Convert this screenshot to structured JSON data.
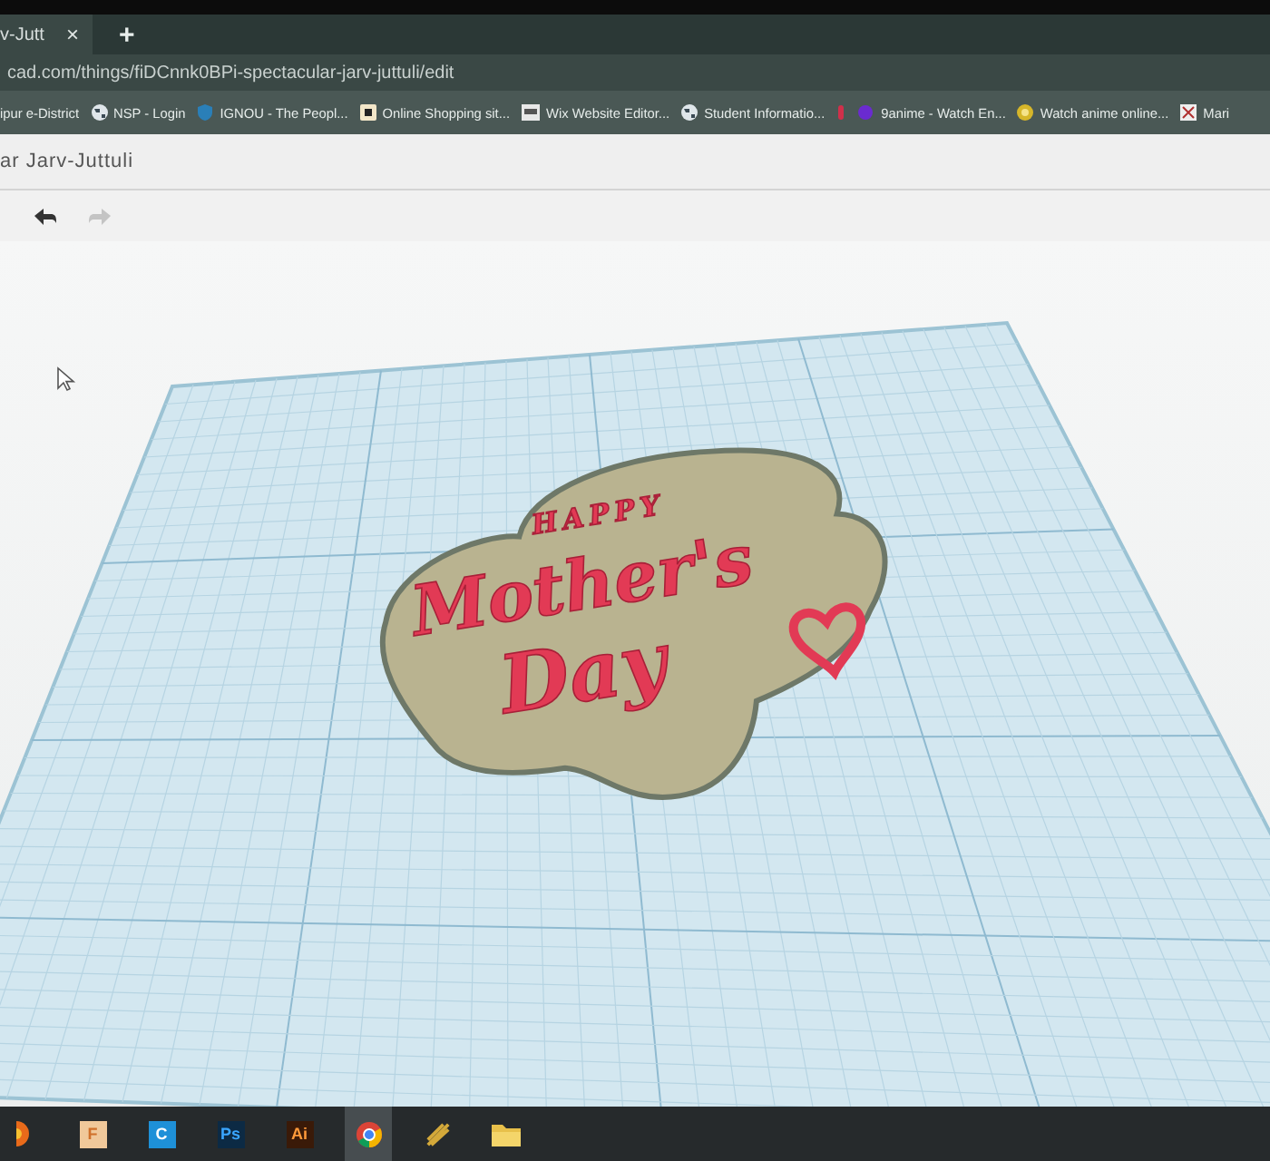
{
  "browser": {
    "tab": {
      "title": "v-Jutt",
      "close": "×"
    },
    "new_tab": "+",
    "address": "cad.com/things/fiDCnnk0BPi-spectacular-jarv-juttuli/edit",
    "bookmarks": [
      {
        "label": "ipur e-District",
        "kind": "none"
      },
      {
        "label": "NSP - Login",
        "kind": "globe"
      },
      {
        "label": "IGNOU - The Peopl...",
        "kind": "shield"
      },
      {
        "label": "Online Shopping sit...",
        "kind": "cart"
      },
      {
        "label": "Wix Website Editor...",
        "kind": "wix"
      },
      {
        "label": "Student Informatio...",
        "kind": "globe"
      },
      {
        "label": "9anime - Watch En...",
        "kind": "pins"
      },
      {
        "label": "Watch anime online...",
        "kind": "star"
      },
      {
        "label": "Mari",
        "kind": "grid"
      }
    ]
  },
  "editor": {
    "title": "ar Jarv-Juttuli",
    "toolbar": [
      {
        "kind": "undo",
        "disabled": false
      },
      {
        "kind": "redo",
        "disabled": true
      }
    ]
  },
  "workplane": {
    "model_text": [
      "HAPPY",
      "Mother's",
      "Day"
    ]
  },
  "taskbar": {
    "apps": [
      {
        "kind": "round",
        "selected": false
      },
      {
        "kind": "letter",
        "label": "F",
        "color": "#f0c89a",
        "selected": false
      },
      {
        "kind": "letter",
        "label": "C",
        "color": "#1e90d8",
        "selected": false
      },
      {
        "kind": "letter",
        "label": "Ps",
        "color": "#0c2a44",
        "selected": false
      },
      {
        "kind": "letter",
        "label": "Ai",
        "color": "#3a1a08",
        "selected": false
      },
      {
        "kind": "chrome",
        "selected": true
      },
      {
        "kind": "wing",
        "selected": false
      },
      {
        "kind": "folder",
        "selected": false
      }
    ]
  }
}
